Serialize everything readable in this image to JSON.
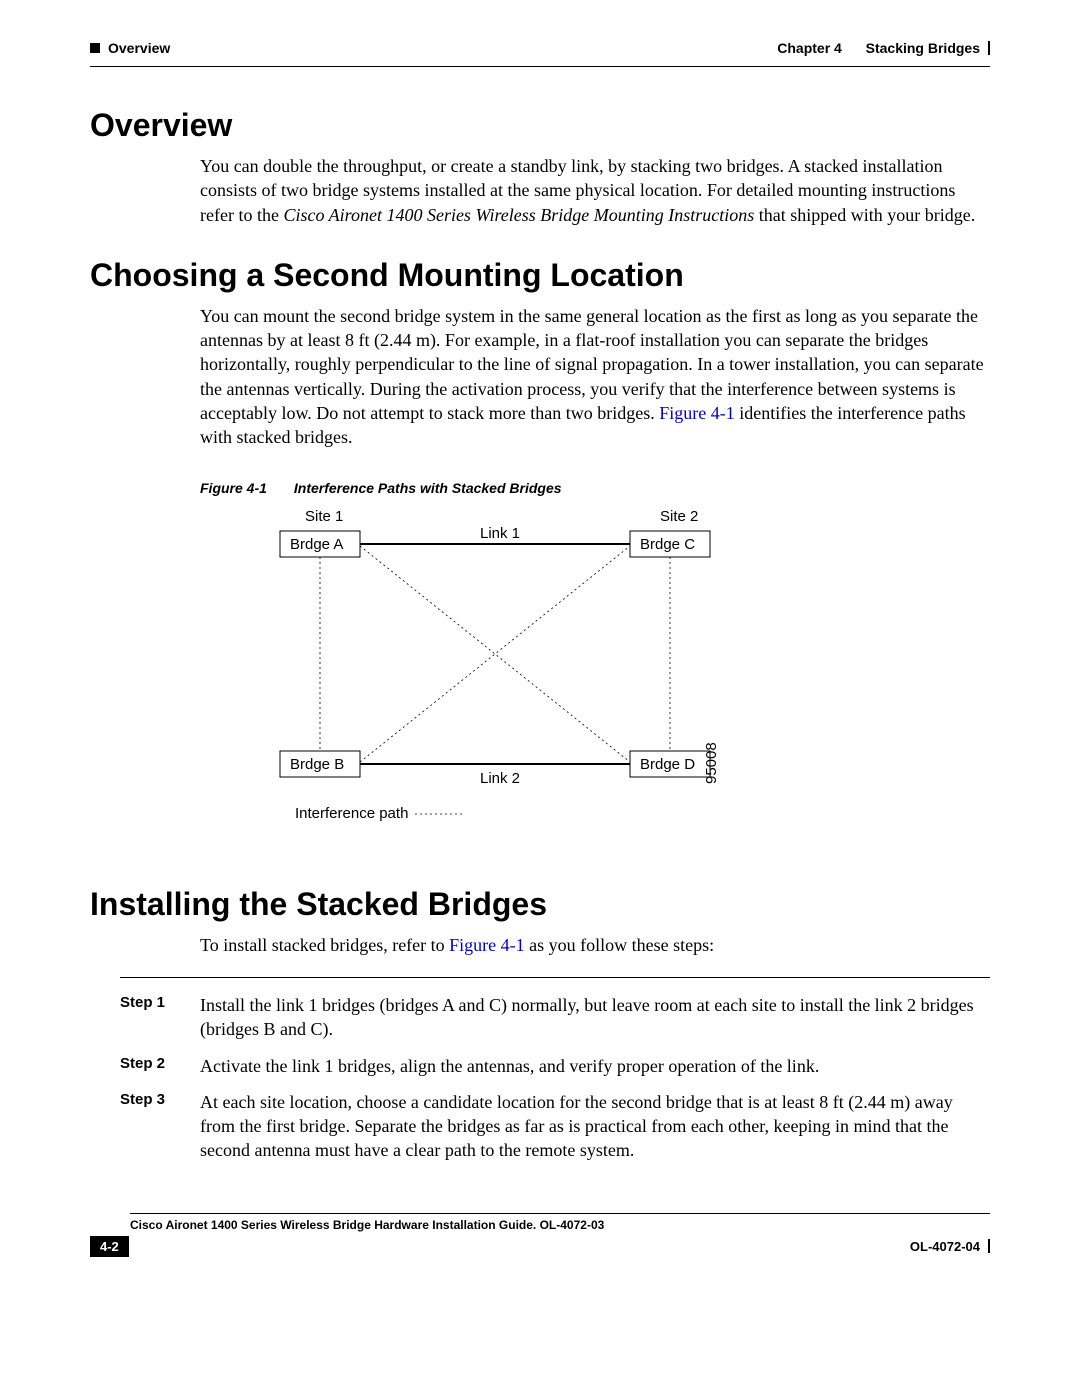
{
  "header": {
    "left_section": "Overview",
    "right_chapter": "Chapter 4",
    "right_title": "Stacking Bridges"
  },
  "section1": {
    "heading": "Overview",
    "p1a": "You can double the throughput, or create a standby link, by stacking two bridges. A stacked installation consists of two bridge systems installed at the same physical location. For detailed mounting instructions refer to the ",
    "p1b_italic": "Cisco Aironet 1400 Series Wireless Bridge Mounting Instructions",
    "p1c": " that shipped with your bridge."
  },
  "section2": {
    "heading": "Choosing a Second Mounting Location",
    "p1a": "You can mount the second bridge system in the same general location as the first as long as you separate the antennas by at least 8 ft (2.44 m). For example, in a flat-roof installation you can separate the bridges horizontally, roughly perpendicular to the line of signal propagation. In a tower installation, you can separate the antennas vertically. During the activation process, you verify that the interference between systems is acceptably low. Do not attempt to stack more than two bridges. ",
    "p1b_link": "Figure 4-1",
    "p1c": " identifies the interference paths with stacked bridges."
  },
  "figure": {
    "label": "Figure 4-1",
    "caption": "Interference Paths with Stacked Bridges",
    "site1": "Site 1",
    "site2": "Site 2",
    "bridgeA": "Brdge A",
    "bridgeB": "Brdge B",
    "bridgeC": "Brdge C",
    "bridgeD": "Brdge D",
    "link1": "Link 1",
    "link2": "Link 2",
    "legend": "Interference path",
    "idnum": "95008"
  },
  "section3": {
    "heading": "Installing the Stacked Bridges",
    "intro_a": "To install stacked bridges, refer to ",
    "intro_link": "Figure 4-1",
    "intro_b": " as you follow these steps:",
    "steps": [
      {
        "label": "Step 1",
        "text": "Install the link 1 bridges (bridges A and C) normally, but leave room at each site to install the link 2 bridges (bridges B and C)."
      },
      {
        "label": "Step 2",
        "text": "Activate the link 1 bridges, align the antennas, and verify proper operation of the link."
      },
      {
        "label": "Step 3",
        "text": "At each site location, choose a candidate location for the second bridge that is at least  8 ft (2.44 m) away from the first bridge. Separate the bridges as far as is practical from each other, keeping in mind that the second antenna must have a clear path to the remote system."
      }
    ]
  },
  "footer": {
    "guide": "Cisco Aironet 1400 Series Wireless Bridge Hardware Installation Guide. OL-4072-03",
    "page": "4-2",
    "docid": "OL-4072-04"
  }
}
